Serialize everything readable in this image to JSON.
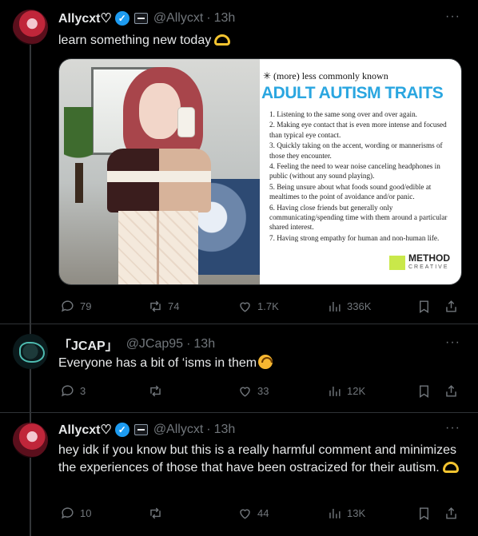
{
  "tweets": [
    {
      "name": "Allycxt♡",
      "handle": "@Allycxt",
      "time": "13h",
      "text": "learn something new today",
      "replies": "79",
      "reposts": "74",
      "likes": "1.7K",
      "views": "336K"
    },
    {
      "name": "「JCAP」",
      "handle": "@JCap95",
      "time": "13h",
      "text": "Everyone has a bit of ‘isms in them",
      "replies": "3",
      "reposts": "",
      "likes": "33",
      "views": "12K"
    },
    {
      "name": "Allycxt♡",
      "handle": "@Allycxt",
      "time": "13h",
      "text": "hey idk if you know but this is a really harmful comment and minimizes the experiences of those that have been ostracized for their autism.",
      "replies": "10",
      "reposts": "",
      "likes": "44",
      "views": "13K"
    }
  ],
  "separator_dot": "·",
  "more_label": "···",
  "verified_mark": "✓",
  "card": {
    "kicker": "✳ (more) less commonly known",
    "title": "ADULT AUTISM TRAITS",
    "items": [
      "1. Listening to the same song over and over again.",
      "2. Making eye contact that is even more intense and focused than typical eye contact.",
      "3. Quickly taking on the accent, wording or mannerisms of those they encounter.",
      "4. Feeling the need to wear noise canceling headphones in public (without any sound playing).",
      "5. Being unsure about what foods sound good/edible at mealtimes to the point of avoidance and/or panic.",
      "6. Having close friends but generally only communicating/spending time with them around a particular shared interest.",
      "7. Having strong empathy for human and non-human life."
    ],
    "logo_main": "METHOD",
    "logo_sub": "CREATIVE"
  },
  "colors": {
    "background": "#000000",
    "text": "#e7e9ea",
    "muted": "#71767b",
    "verified": "#1d9bf0",
    "card_title": "#2aa6e0"
  }
}
